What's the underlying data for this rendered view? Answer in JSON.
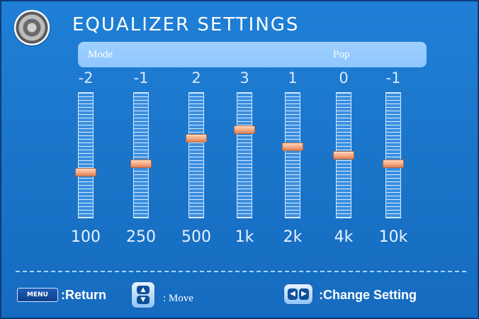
{
  "header": {
    "title": "EQUALIZER SETTINGS",
    "icon": "speaker-icon"
  },
  "mode": {
    "label": "Mode",
    "value": "Pop"
  },
  "bands": [
    {
      "freq": "100",
      "value": "-2",
      "level": -2
    },
    {
      "freq": "250",
      "value": "-1",
      "level": -1
    },
    {
      "freq": "500",
      "value": "2",
      "level": 2
    },
    {
      "freq": "1k",
      "value": "3",
      "level": 3
    },
    {
      "freq": "2k",
      "value": "1",
      "level": 1
    },
    {
      "freq": "4k",
      "value": "0",
      "level": 0
    },
    {
      "freq": "10k",
      "value": "-1",
      "level": -1
    }
  ],
  "level_range": [
    -7,
    7
  ],
  "footer": {
    "menu_key": "MENU",
    "return_label": ":Return",
    "move_label": ": Move",
    "change_label": ":Change Setting"
  },
  "colors": {
    "background": "#1a74c8",
    "mode_bar": "#8ec6ff",
    "thumb": "#f4a27a"
  }
}
